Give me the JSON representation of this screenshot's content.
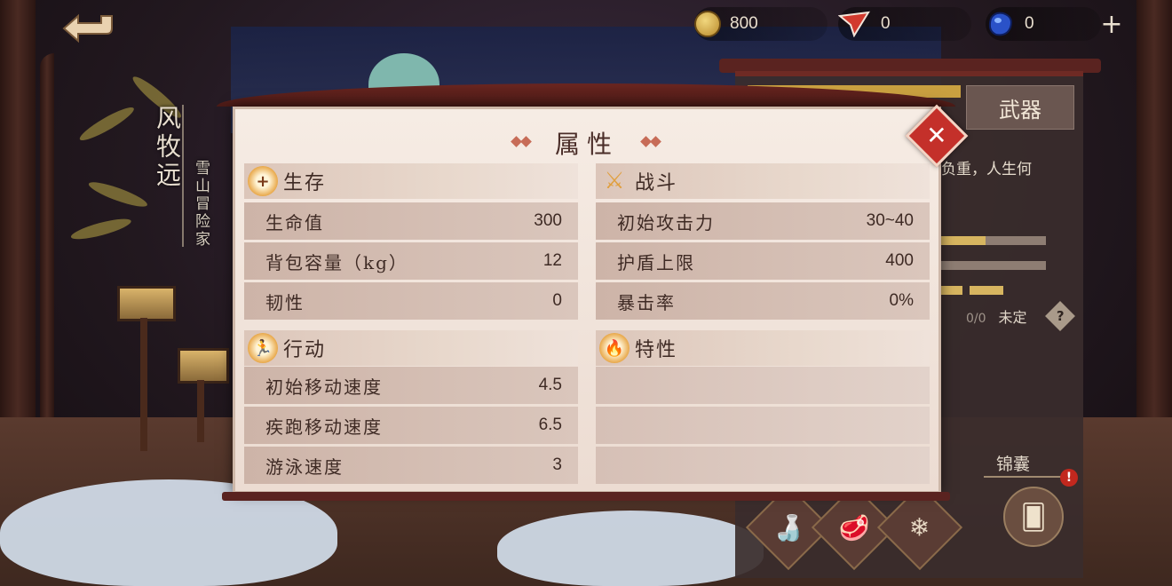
{
  "currencies": [
    {
      "icon": "gold-coin-icon",
      "value": "800"
    },
    {
      "icon": "paper-plane-icon",
      "value": "0"
    },
    {
      "icon": "blue-gem-icon",
      "value": "0"
    }
  ],
  "add_currency_label": "+",
  "character": {
    "name": "风牧远",
    "title": "雪山冒险家"
  },
  "side_panel": {
    "weapon_tab": "武器",
    "quote": "负重，人生何",
    "undecided_count": "0/0",
    "undecided_label": "未定",
    "help_label": "?",
    "bag_label": "锦囊",
    "alert_label": "!",
    "slots": [
      "bottle-icon",
      "food-icon",
      "snowflake-icon"
    ],
    "card_icon": "card-icon"
  },
  "dialog": {
    "title": "属性",
    "close_label": "✕",
    "sections": {
      "survival": {
        "label": "生存",
        "rows": [
          {
            "key": "生命值",
            "value": "300"
          },
          {
            "key": "背包容量（kg）",
            "value": "12"
          },
          {
            "key": "韧性",
            "value": "0"
          }
        ]
      },
      "combat": {
        "label": "战斗",
        "rows": [
          {
            "key": "初始攻击力",
            "value": "30~40"
          },
          {
            "key": "护盾上限",
            "value": "400"
          },
          {
            "key": "暴击率",
            "value": "0%"
          }
        ]
      },
      "action": {
        "label": "行动",
        "rows": [
          {
            "key": "初始移动速度",
            "value": "4.5"
          },
          {
            "key": "疾跑移动速度",
            "value": "6.5"
          },
          {
            "key": "游泳速度",
            "value": "3"
          }
        ]
      },
      "traits": {
        "label": "特性",
        "rows": []
      }
    }
  },
  "colors": {
    "accent_red": "#c4302a",
    "panel_bg": "#f6ece4",
    "text_dark": "#3e2a24",
    "gold": "#e0a040"
  }
}
